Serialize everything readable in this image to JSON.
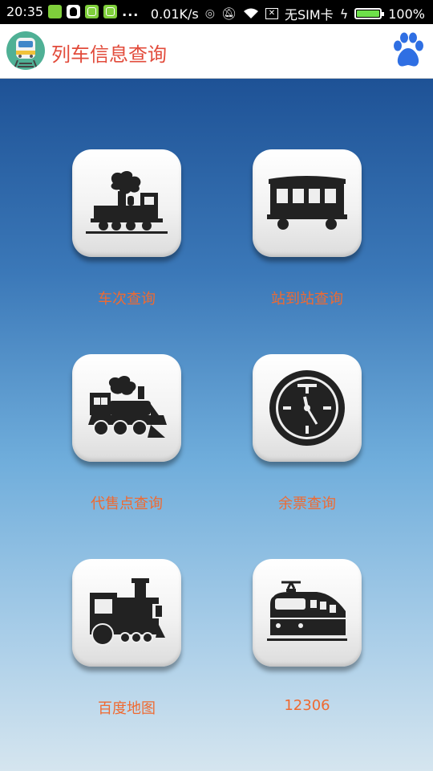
{
  "status_bar": {
    "time": "20:35",
    "more": "...",
    "speed": "0.01K/s",
    "sim": "无SIM卡",
    "battery": "100%",
    "battery_level": 1.0
  },
  "app_bar": {
    "title": "列车信息查询"
  },
  "menu": [
    {
      "label": "车次查询",
      "icon": "steam-locomotive-icon"
    },
    {
      "label": "站到站查询",
      "icon": "passenger-car-icon"
    },
    {
      "label": "代售点查询",
      "icon": "steam-engine-icon"
    },
    {
      "label": "余票查询",
      "icon": "clock-icon"
    },
    {
      "label": "百度地图",
      "icon": "locomotive-icon"
    },
    {
      "label": "12306",
      "icon": "electric-train-icon"
    }
  ],
  "colors": {
    "title": "#e24b3b",
    "label": "#ef6a31",
    "bg_top": "#1e5296",
    "bg_bottom": "#d5e5ef",
    "paw": "#2f6fe3"
  }
}
